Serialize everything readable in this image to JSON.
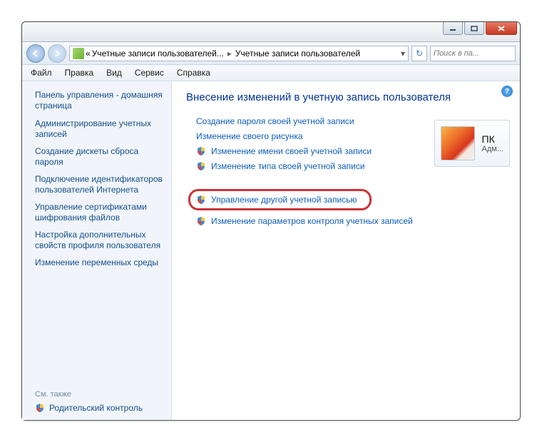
{
  "breadcrumb": {
    "prefix": "«",
    "seg1": "Учетные записи пользователей...",
    "seg2": "Учетные записи пользователей"
  },
  "search": {
    "placeholder": "Поиск в па..."
  },
  "menu": {
    "file": "Файл",
    "edit": "Правка",
    "view": "Вид",
    "tools": "Сервис",
    "help": "Справка"
  },
  "sidebar": {
    "title": "Панель управления - домашняя страница",
    "items": [
      "Администрирование учетных записей",
      "Создание дискеты сброса пароля",
      "Подключение идентификаторов пользователей Интернета",
      "Управление сертификатами шифрования файлов",
      "Настройка дополнительных свойств профиля пользователя",
      "Изменение переменных среды"
    ],
    "seeAlsoLabel": "См. также",
    "seeAlso": "Родительский контроль"
  },
  "main": {
    "title": "Внесение изменений в учетную запись пользователя",
    "tasks": [
      {
        "label": "Создание пароля своей учетной записи",
        "shield": false
      },
      {
        "label": "Изменение своего рисунка",
        "shield": false
      },
      {
        "label": "Изменение имени своей учетной записи",
        "shield": true
      },
      {
        "label": "Изменение типа своей учетной записи",
        "shield": true
      }
    ],
    "highlightTask": {
      "label": "Управление другой учетной записью",
      "shield": true
    },
    "lastTask": {
      "label": "Изменение параметров контроля учетных записей",
      "shield": true
    }
  },
  "account": {
    "name": "ПК",
    "role": "Адм..."
  }
}
